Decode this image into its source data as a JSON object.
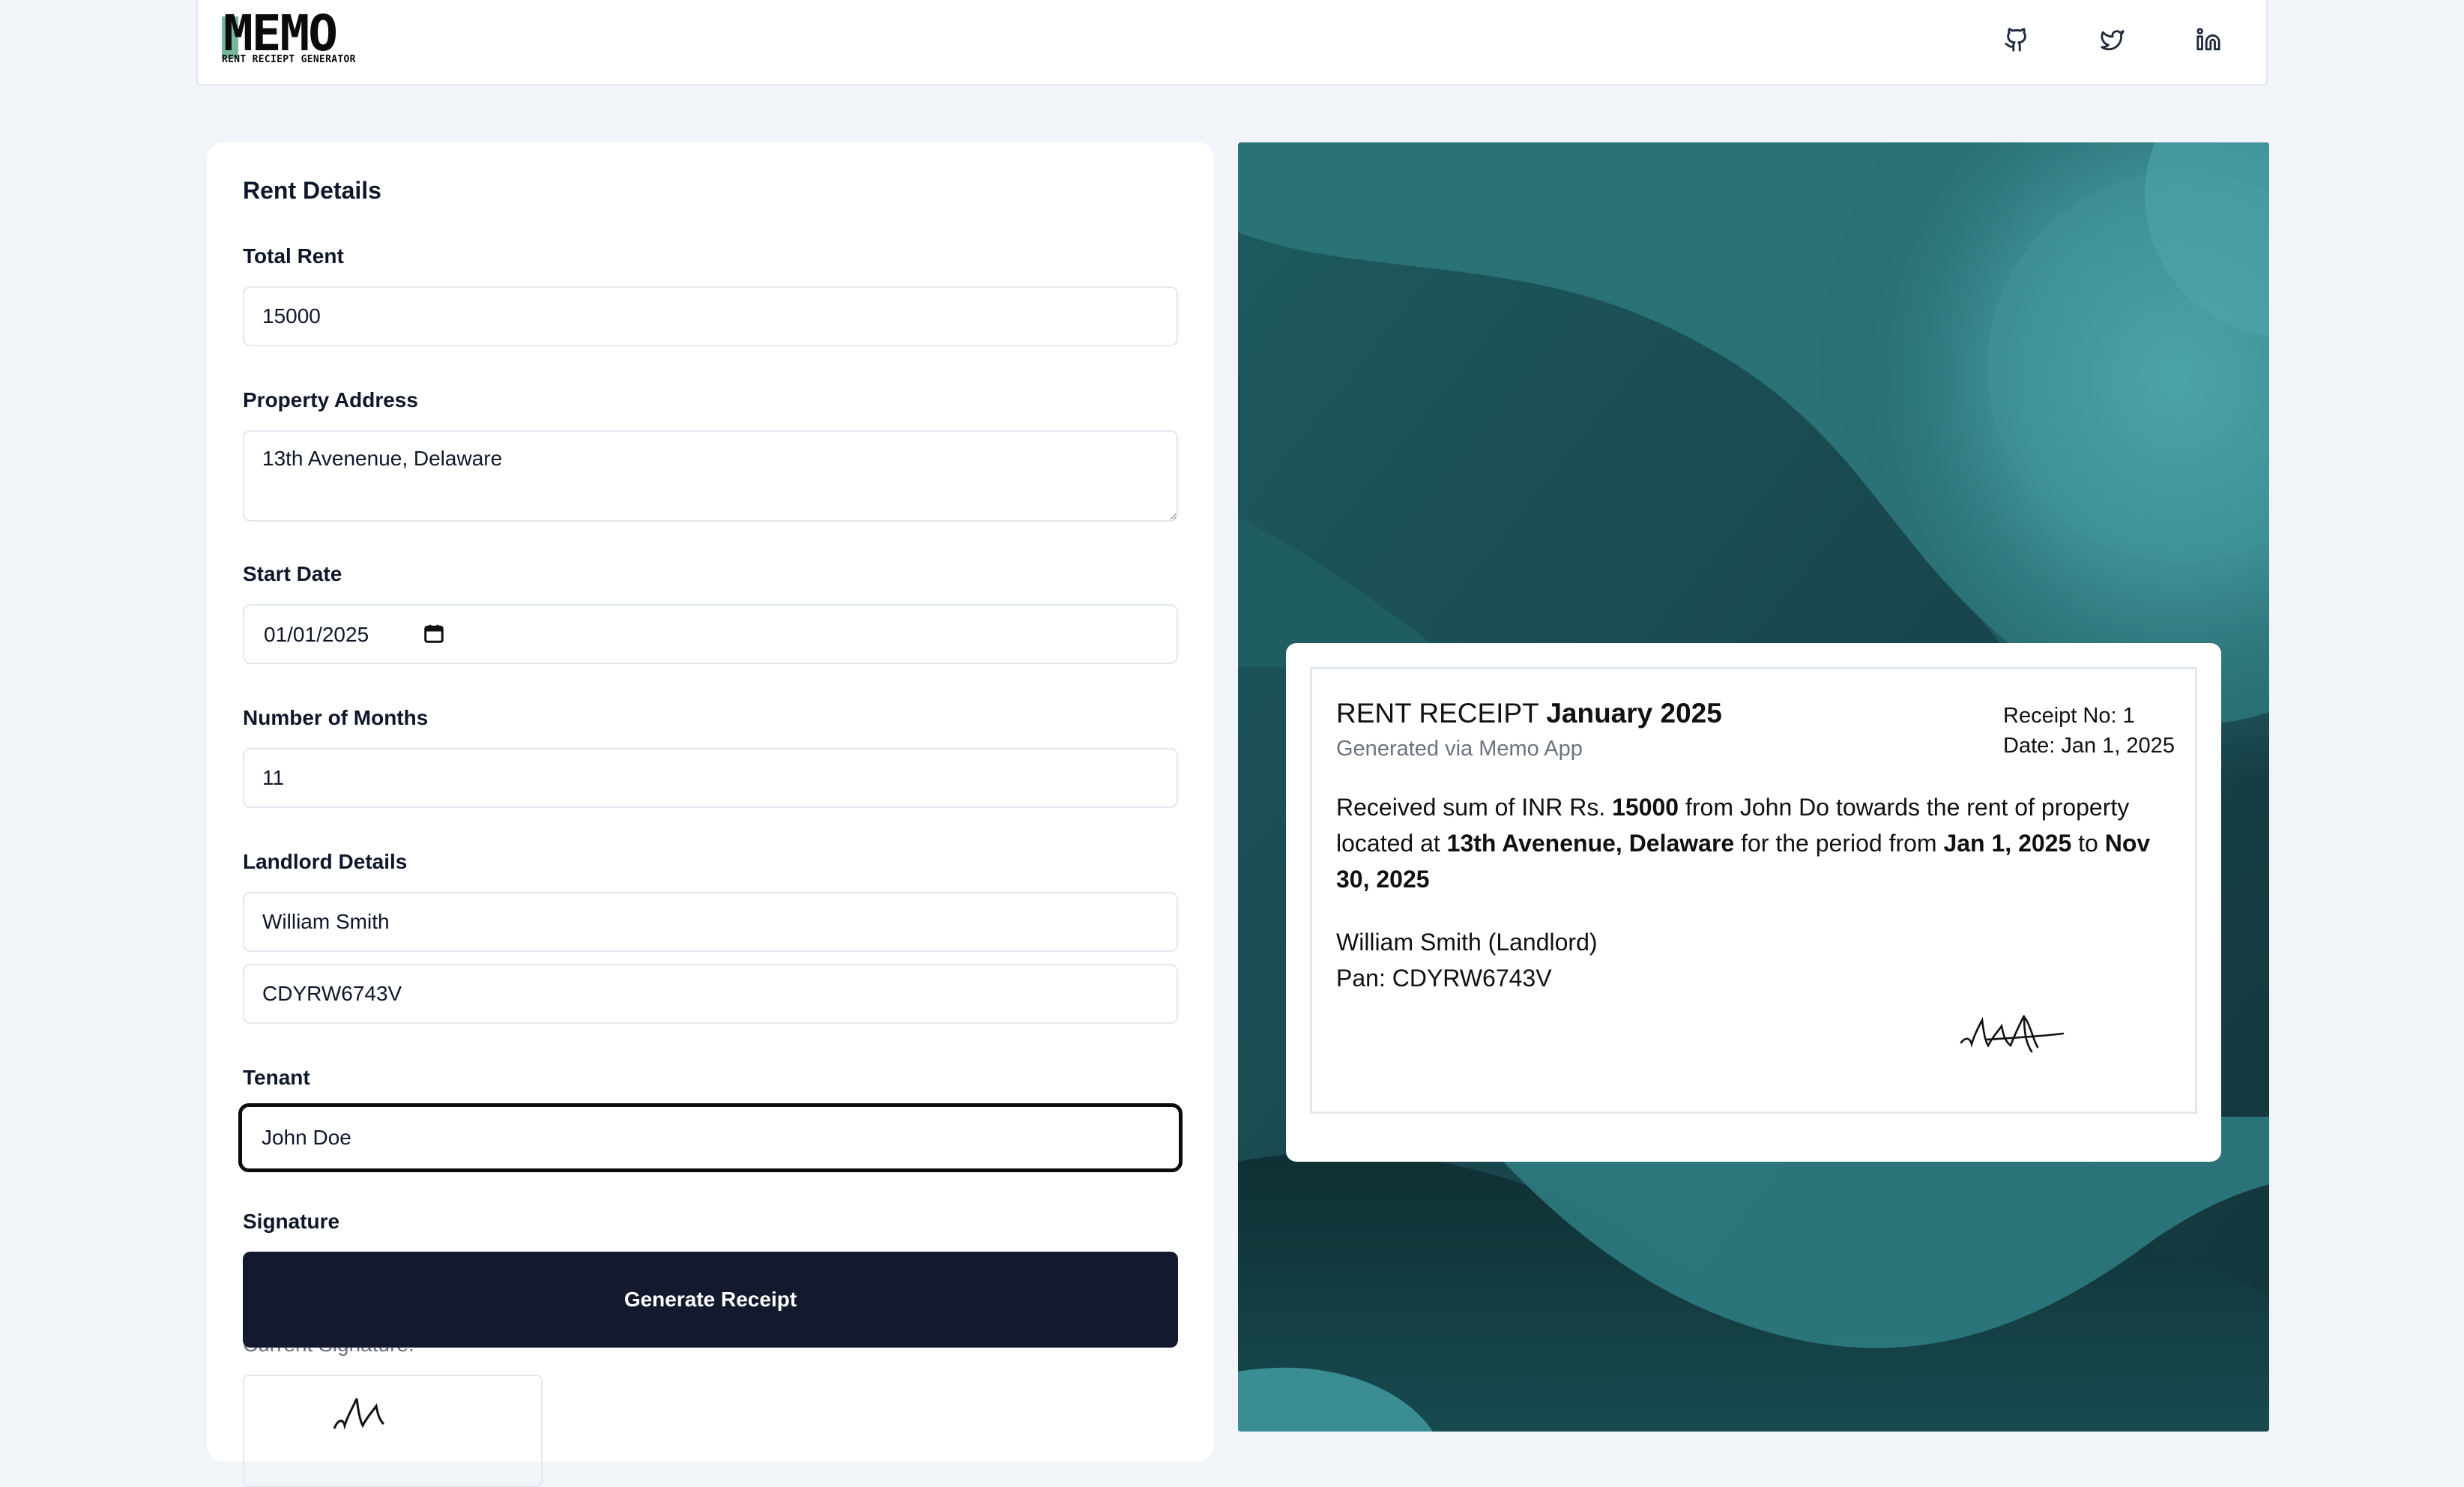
{
  "nav": {
    "logo_word": "MEMO",
    "logo_sub": "RENT RECIEPT GENERATOR",
    "icons": [
      "github-icon",
      "twitter-icon",
      "linkedin-icon"
    ]
  },
  "form": {
    "title": "Rent Details",
    "total_rent_label": "Total Rent",
    "total_rent_value": "15000",
    "address_label": "Property Address",
    "address_value": "13th Avenenue, Delaware",
    "start_date_label": "Start Date",
    "start_date_value": "01/01/2025",
    "months_label": "Number of Months",
    "months_value": "11",
    "landlord_label": "Landlord Details",
    "landlord_name_value": "William Smith",
    "landlord_pan_value": "CDYRW6743V",
    "tenant_label": "Tenant",
    "tenant_value": "John Doe",
    "signature_label": "Signature",
    "generate_button": "Generate Receipt",
    "current_signature_label": "Current Signature:"
  },
  "receipt": {
    "title_prefix": "RENT RECEIPT",
    "title_month": "January 2025",
    "generated_via": "Generated via Memo App",
    "receipt_no": "Receipt No: 1",
    "date": "Date: Jan 1, 2025",
    "body": {
      "p1": "Received sum of INR Rs. ",
      "amount": "15000",
      "p2": " from John Do towards the rent of property located at ",
      "address": "13th Avenenue, Delaware",
      "p3": " for the period from ",
      "from": "Jan 1, 2025",
      "p4": " to ",
      "to": "Nov 30, 2025"
    },
    "landlord_line": "William Smith (Landlord)",
    "pan_line": "Pan: CDYRW6743V"
  },
  "colors": {
    "page_bg": "#f1f5f9",
    "button_bg": "#131a2e",
    "logo_accent": "#76b79e",
    "preview_teal": "#2f7f84"
  }
}
